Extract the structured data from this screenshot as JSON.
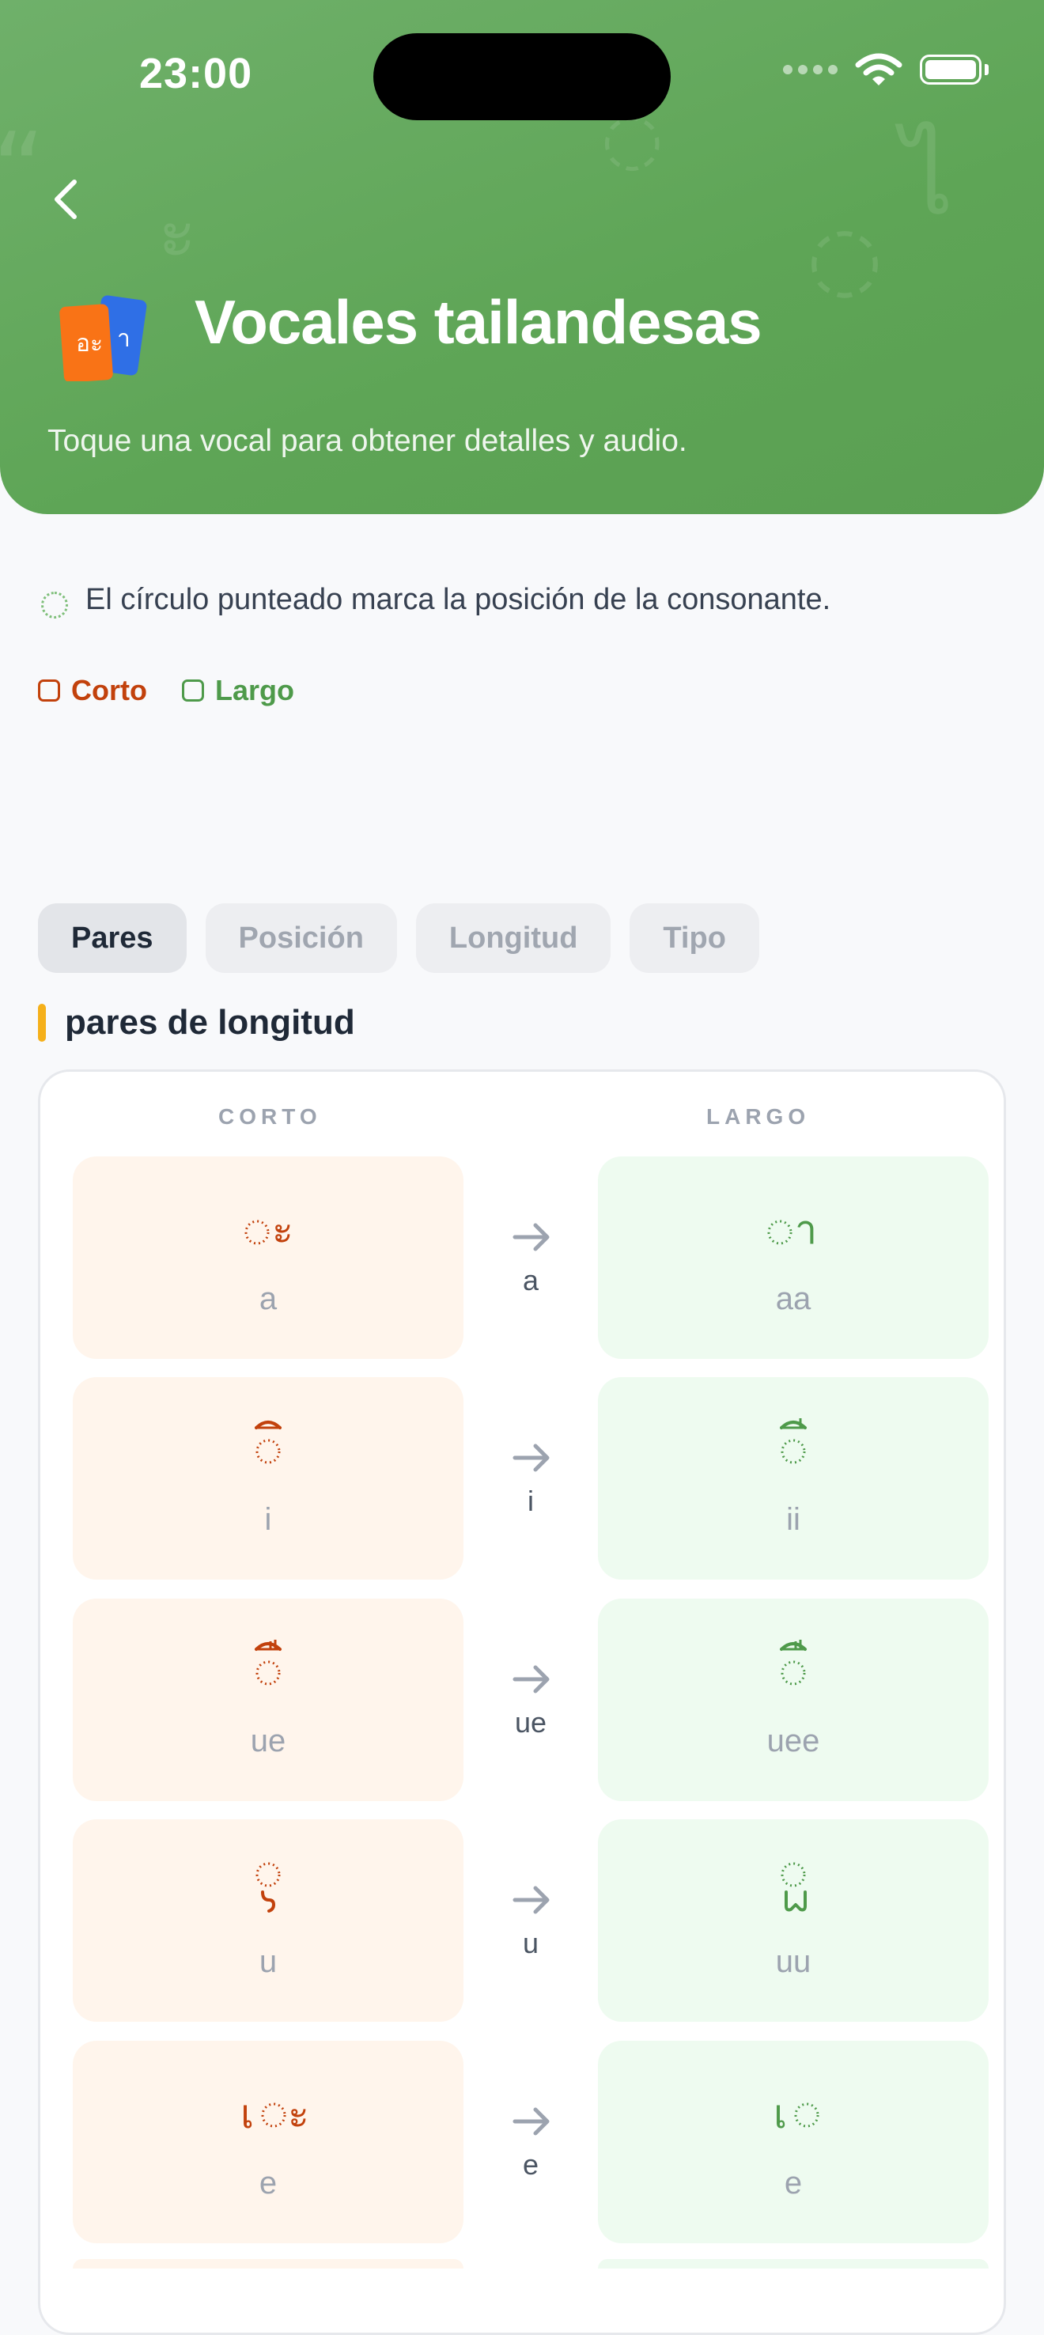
{
  "status_bar": {
    "time": "23:00"
  },
  "header": {
    "title": "Vocales tailandesas",
    "subtitle": "Toque una vocal para obtener detalles y audio.",
    "icon_text": "อะา",
    "bg_color": "#5EA556"
  },
  "note": "El círculo punteado marca la posición de la consonante.",
  "legend": {
    "short_label": "Corto",
    "long_label": "Largo",
    "short_color": "#C2410C",
    "long_color": "#4E9A4A"
  },
  "tabs": [
    {
      "label": "Pares",
      "active": true
    },
    {
      "label": "Posición",
      "active": false
    },
    {
      "label": "Longitud",
      "active": false
    },
    {
      "label": "Tipo",
      "active": false
    }
  ],
  "section_title": "pares de longitud",
  "columns": {
    "short": "CORTO",
    "long": "LARGO"
  },
  "pairs": [
    {
      "short_rom": "a",
      "long_rom": "aa",
      "arrow_label": "a"
    },
    {
      "short_rom": "i",
      "long_rom": "ii",
      "arrow_label": "i"
    },
    {
      "short_rom": "ue",
      "long_rom": "uee",
      "arrow_label": "ue"
    },
    {
      "short_rom": "u",
      "long_rom": "uu",
      "arrow_label": "u"
    },
    {
      "short_rom": "e",
      "long_rom": "e",
      "arrow_label": "e"
    }
  ]
}
